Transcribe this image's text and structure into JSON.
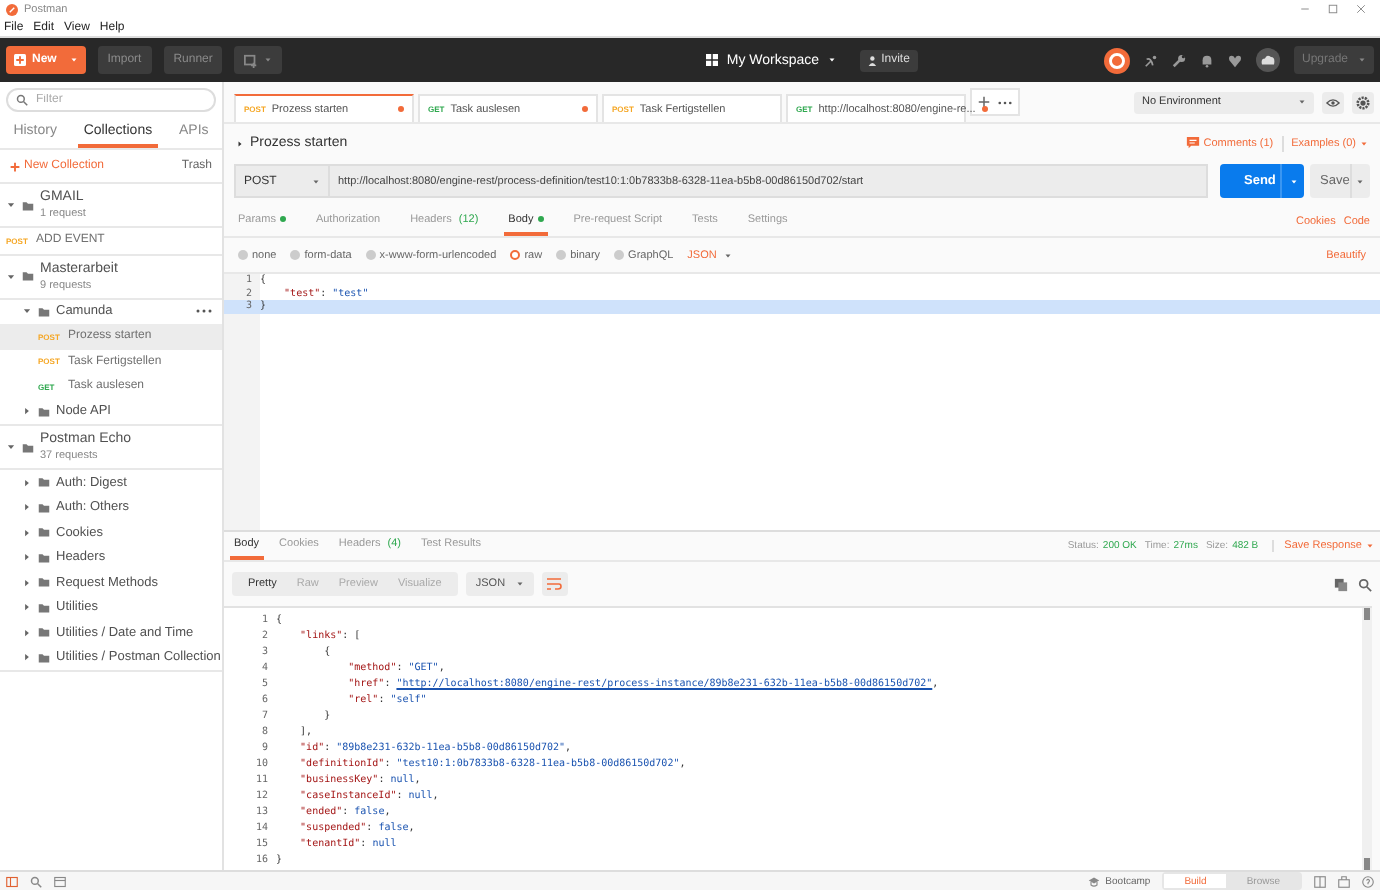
{
  "window": {
    "title": "Postman"
  },
  "menu": [
    "File",
    "Edit",
    "View",
    "Help"
  ],
  "header": {
    "new": "New",
    "import": "Import",
    "runner": "Runner",
    "workspace": "My Workspace",
    "invite": "Invite",
    "upgrade": "Upgrade"
  },
  "sidebar": {
    "filter": {
      "placeholder": "Filter"
    },
    "tabs": [
      {
        "label": "History",
        "selected": false
      },
      {
        "label": "Collections",
        "selected": true
      },
      {
        "label": "APIs",
        "selected": false
      }
    ],
    "new_collection": "New Collection",
    "trash": "Trash",
    "collections": [
      {
        "name": "GMAIL",
        "count": "1 request",
        "expanded": true,
        "children": [
          {
            "kind": "request",
            "method": "POST",
            "color": "#f5a623",
            "name": "ADD EVENT",
            "selected": false
          }
        ]
      },
      {
        "name": "Masterarbeit",
        "count": "9 requests",
        "expanded": true,
        "children": [
          {
            "kind": "folder",
            "name": "Camunda",
            "expanded": true,
            "hovered": true,
            "children": [
              {
                "kind": "request",
                "method": "POST",
                "color": "#f5a623",
                "name": "Prozess starten",
                "selected": true
              },
              {
                "kind": "request",
                "method": "POST",
                "color": "#f5a623",
                "name": "Task Fertigstellen",
                "selected": false
              },
              {
                "kind": "request",
                "method": "GET",
                "color": "#2fa84f",
                "name": "Task auslesen",
                "selected": false
              }
            ]
          },
          {
            "kind": "folder",
            "name": "Node API",
            "expanded": false,
            "hovered": false
          }
        ]
      },
      {
        "name": "Postman Echo",
        "count": "37 requests",
        "expanded": true,
        "children": [
          {
            "kind": "folder",
            "name": "Auth: Digest",
            "expanded": false,
            "hovered": false
          },
          {
            "kind": "folder",
            "name": "Auth: Others",
            "expanded": false,
            "hovered": false
          },
          {
            "kind": "folder",
            "name": "Cookies",
            "expanded": false,
            "hovered": false
          },
          {
            "kind": "folder",
            "name": "Headers",
            "expanded": false,
            "hovered": false
          },
          {
            "kind": "folder",
            "name": "Request Methods",
            "expanded": false,
            "hovered": false
          },
          {
            "kind": "folder",
            "name": "Utilities",
            "expanded": false,
            "hovered": false
          },
          {
            "kind": "folder",
            "name": "Utilities / Date and Time",
            "expanded": false,
            "hovered": false
          },
          {
            "kind": "folder",
            "name": "Utilities / Postman Collection",
            "expanded": false,
            "hovered": false
          }
        ]
      }
    ]
  },
  "tabs": [
    {
      "method": "POST",
      "color": "#f5a623",
      "title": "Prozess starten",
      "selected": true,
      "unsaved": true
    },
    {
      "method": "GET",
      "color": "#2fa84f",
      "title": "Task auslesen",
      "selected": false,
      "unsaved": true
    },
    {
      "method": "POST",
      "color": "#f5a623",
      "title": "Task Fertigstellen",
      "selected": false,
      "unsaved": false
    },
    {
      "method": "GET",
      "color": "#2fa84f",
      "title": "http://localhost:8080/engine-re...",
      "selected": false,
      "unsaved": true
    }
  ],
  "environment": "No Environment",
  "request": {
    "name": "Prozess starten",
    "comments": "Comments (1)",
    "examples": "Examples (0)",
    "method": "POST",
    "url": "http://localhost:8080/engine-rest/process-definition/test10:1:0b7833b8-6328-11ea-b5b8-00d86150d702/start",
    "send": "Send",
    "save": "Save",
    "tabs": [
      {
        "label": "Params",
        "dot": true,
        "selected": false
      },
      {
        "label": "Authorization",
        "dot": false,
        "selected": false
      },
      {
        "label": "Headers",
        "count": "(12)",
        "dot": false,
        "selected": false
      },
      {
        "label": "Body",
        "dot": true,
        "selected": true
      },
      {
        "label": "Pre-request Script",
        "dot": false,
        "selected": false
      },
      {
        "label": "Tests",
        "dot": false,
        "selected": false
      },
      {
        "label": "Settings",
        "dot": false,
        "selected": false
      }
    ],
    "links": [
      "Cookies",
      "Code"
    ],
    "body_types": [
      {
        "label": "none",
        "selected": false
      },
      {
        "label": "form-data",
        "selected": false
      },
      {
        "label": "x-www-form-urlencoded",
        "selected": false
      },
      {
        "label": "raw",
        "selected": true
      },
      {
        "label": "binary",
        "selected": false
      },
      {
        "label": "GraphQL",
        "selected": false
      }
    ],
    "format": "JSON",
    "beautify": "Beautify",
    "lines": [
      {
        "number": "1",
        "text": "{",
        "active": false
      },
      {
        "number": "2",
        "text": "    \"test\": \"test\"",
        "active": false
      },
      {
        "number": "3",
        "text": "}",
        "active": true
      }
    ]
  },
  "response": {
    "tabs": [
      {
        "label": "Body",
        "selected": true
      },
      {
        "label": "Cookies",
        "selected": false
      },
      {
        "label": "Headers",
        "count": "(4)",
        "selected": false
      },
      {
        "label": "Test Results",
        "selected": false
      }
    ],
    "stats": [
      {
        "label": "Status:",
        "value": "200 OK"
      },
      {
        "label": "Time:",
        "value": "27ms"
      },
      {
        "label": "Size:",
        "value": "482 B"
      }
    ],
    "save": "Save Response",
    "views": [
      {
        "label": "Pretty",
        "selected": true
      },
      {
        "label": "Raw",
        "selected": false
      },
      {
        "label": "Preview",
        "selected": false
      },
      {
        "label": "Visualize",
        "selected": false
      }
    ],
    "format": "JSON",
    "lines": [
      {
        "number": "1",
        "text": "{"
      },
      {
        "number": "2",
        "text": "    \"links\": ["
      },
      {
        "number": "3",
        "text": "        {"
      },
      {
        "number": "4",
        "text": "            \"method\": \"GET\","
      },
      {
        "number": "5",
        "text": "            \"href\": \"http://localhost:8080/engine-rest/process-instance/89b8e231-632b-11ea-b5b8-00d86150d702\",",
        "link": true
      },
      {
        "number": "6",
        "text": "            \"rel\": \"self\""
      },
      {
        "number": "7",
        "text": "        }"
      },
      {
        "number": "8",
        "text": "    ],"
      },
      {
        "number": "9",
        "text": "    \"id\": \"89b8e231-632b-11ea-b5b8-00d86150d702\","
      },
      {
        "number": "10",
        "text": "    \"definitionId\": \"test10:1:0b7833b8-6328-11ea-b5b8-00d86150d702\","
      },
      {
        "number": "11",
        "text": "    \"businessKey\": null,"
      },
      {
        "number": "12",
        "text": "    \"caseInstanceId\": null,"
      },
      {
        "number": "13",
        "text": "    \"ended\": false,"
      },
      {
        "number": "14",
        "text": "    \"suspended\": false,"
      },
      {
        "number": "15",
        "text": "    \"tenantId\": null"
      },
      {
        "number": "16",
        "text": "}"
      }
    ]
  },
  "status_bar": {
    "bootcamp": "Bootcamp",
    "modes": [
      {
        "label": "Build",
        "selected": true
      },
      {
        "label": "Browse",
        "selected": false
      }
    ]
  }
}
